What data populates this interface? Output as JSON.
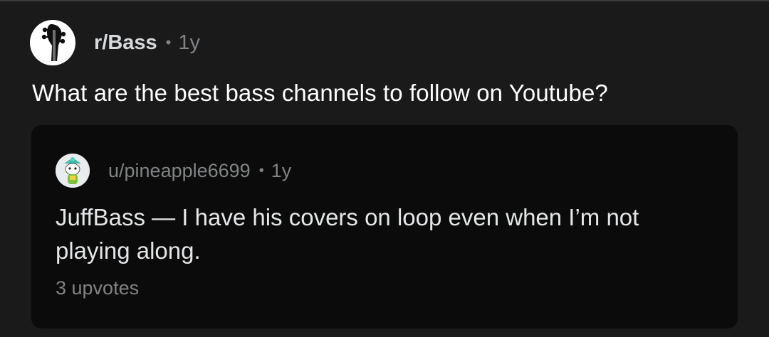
{
  "post": {
    "subreddit": "r/Bass",
    "separator": "•",
    "age": "1y",
    "title": "What are the best bass channels to follow on Youtube?",
    "subreddit_icon": "bass-headstock-icon"
  },
  "comment": {
    "username": "u/pineapple6699",
    "separator": "•",
    "age": "1y",
    "body": "JuffBass — I have his covers on loop even when I’m not playing along.",
    "upvotes": "3 upvotes",
    "avatar_icon": "snoo-avatar-icon"
  },
  "colors": {
    "background": "#1a1a1b",
    "card": "#0b0b0b",
    "text_primary": "#ffffff",
    "text_secondary": "#818384"
  }
}
